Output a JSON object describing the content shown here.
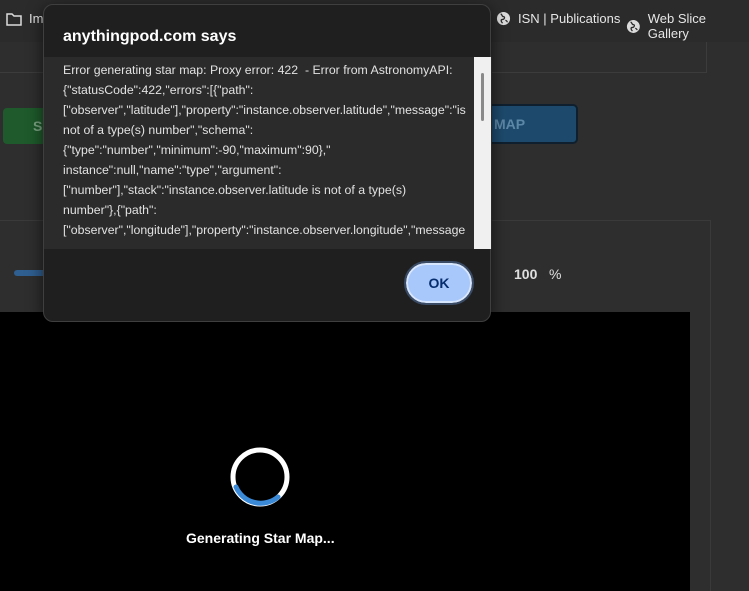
{
  "bookmarks": {
    "folder_label": "Im",
    "isn_label": "ISN | Publications",
    "webslice_label": "Web Slice Gallery"
  },
  "page": {
    "green_button_label": "S",
    "blue_button_label": "R MAP",
    "zoom_value": "100",
    "zoom_unit": "%",
    "loading_text": "Generating Star Map..."
  },
  "dialog": {
    "title": "anythingpod.com says",
    "message": "Error generating star map: Proxy error: 422  - Error from AstronomyAPI: {\"statusCode\":422,\"errors\":[{\"path\":\n[\"observer\",\"latitude\"],\"property\":\"instance.observer.latitude\",\"message\":\"is not of a type(s) number\",\"schema\":\n{\"type\":\"number\",\"minimum\":-90,\"maximum\":90},\"\ninstance\":null,\"name\":\"type\",\"argument\":\n[\"number\"],\"stack\":\"instance.observer.latitude is not of a type(s)\nnumber\"},{\"path\":\n[\"observer\",\"longitude\"],\"property\":\"instance.observer.longitude\",\"message",
    "ok_label": "OK"
  },
  "colors": {
    "ok_button": "#a8c7fa",
    "spinner": "#3b8ad8"
  }
}
